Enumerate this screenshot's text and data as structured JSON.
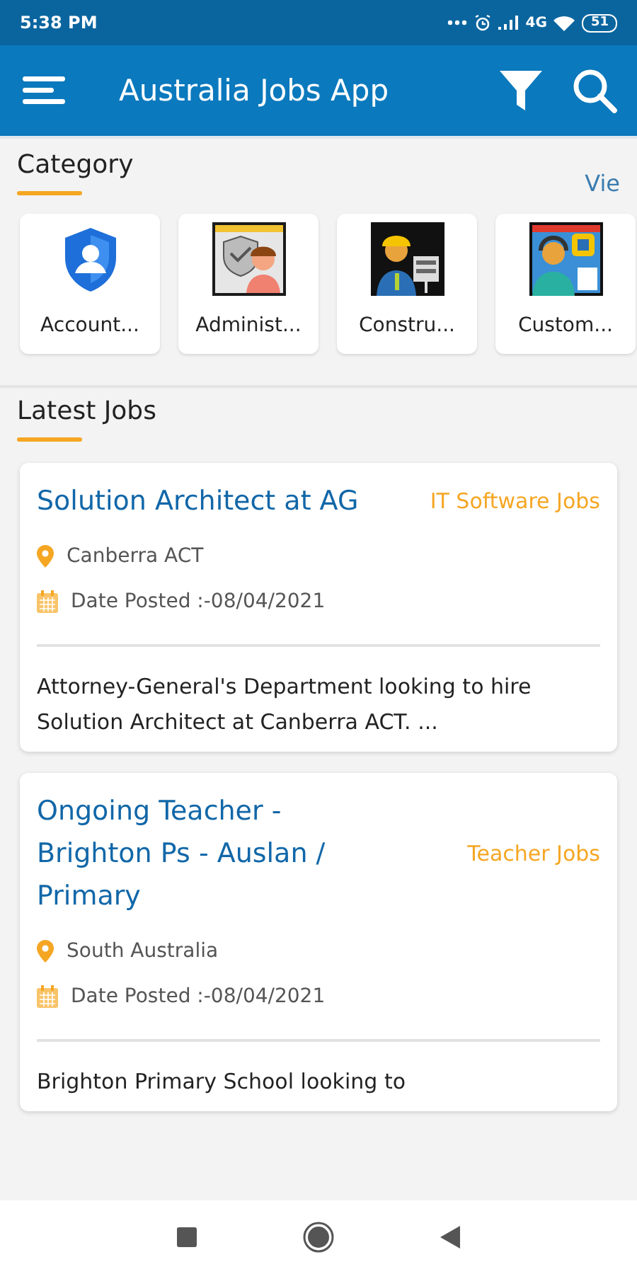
{
  "status_bar": {
    "time": "5:38 PM",
    "network": "4G",
    "battery": "51"
  },
  "app_bar": {
    "title": "Australia Jobs App"
  },
  "category": {
    "heading": "Category",
    "view_link": "Vie",
    "items": [
      {
        "name": "Account...",
        "kind": "shield"
      },
      {
        "name": "Administ...",
        "kind": "admin"
      },
      {
        "name": "Constru...",
        "kind": "construction"
      },
      {
        "name": "Custom...",
        "kind": "support"
      }
    ]
  },
  "latest_jobs": {
    "heading": "Latest Jobs",
    "jobs": [
      {
        "title": "Solution Architect at AG",
        "category": "IT Software Jobs",
        "location": "Canberra ACT",
        "date": "Date Posted :-08/04/2021",
        "description": "Attorney-General's Department looking to hire Solution Architect at Canberra ACT. ..."
      },
      {
        "title": "Ongoing Teacher - Brighton Ps - Auslan / Primary",
        "category": "Teacher Jobs",
        "location": "South Australia",
        "date": "Date Posted :-08/04/2021",
        "description": "Brighton Primary School looking to"
      }
    ]
  }
}
